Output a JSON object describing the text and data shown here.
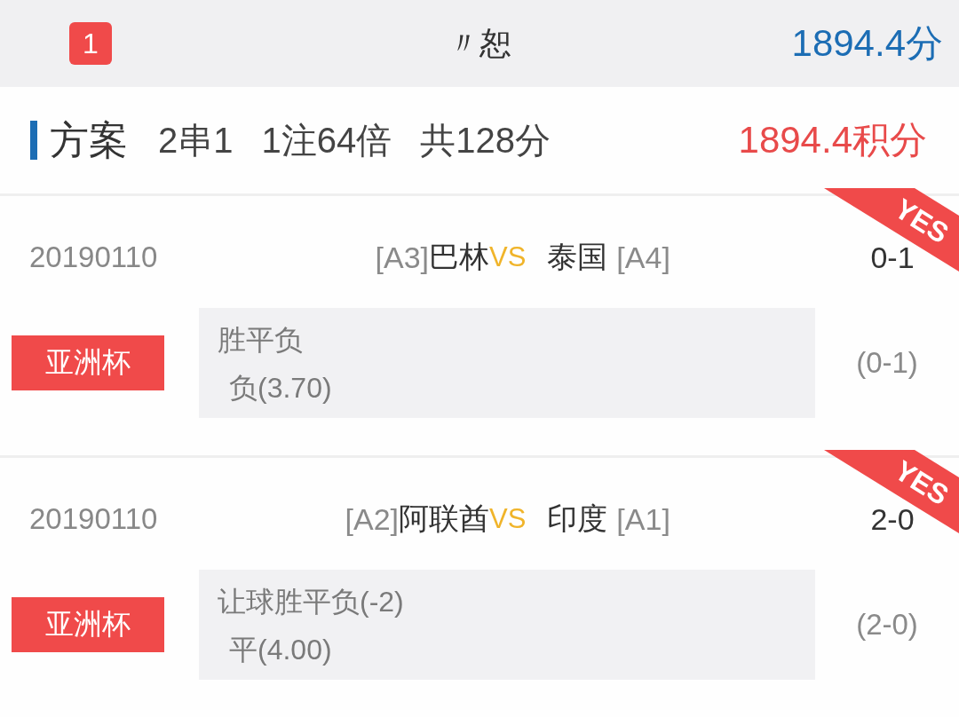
{
  "header": {
    "badge": "1",
    "title": "〃恕",
    "points": "1894.4分"
  },
  "plan": {
    "label": "方案",
    "combo": "2串1",
    "bets": "1注64倍",
    "total": "共128分",
    "result": "1894.4积分"
  },
  "matches": [
    {
      "date": "20190110",
      "home_group": "[A3]",
      "home": "巴林",
      "vs": "VS",
      "away": "泰国",
      "away_group": "[A4]",
      "score": "0-1",
      "ribbon": "YES",
      "league": "亚洲杯",
      "market": "胜平负",
      "pick": "负(3.70)",
      "result": "(0-1)"
    },
    {
      "date": "20190110",
      "home_group": "[A2]",
      "home": "阿联酋",
      "vs": "VS",
      "away": "印度",
      "away_group": "[A1]",
      "score": "2-0",
      "ribbon": "YES",
      "league": "亚洲杯",
      "market": "让球胜平负(-2)",
      "pick": "平(4.00)",
      "result": "(2-0)"
    }
  ]
}
